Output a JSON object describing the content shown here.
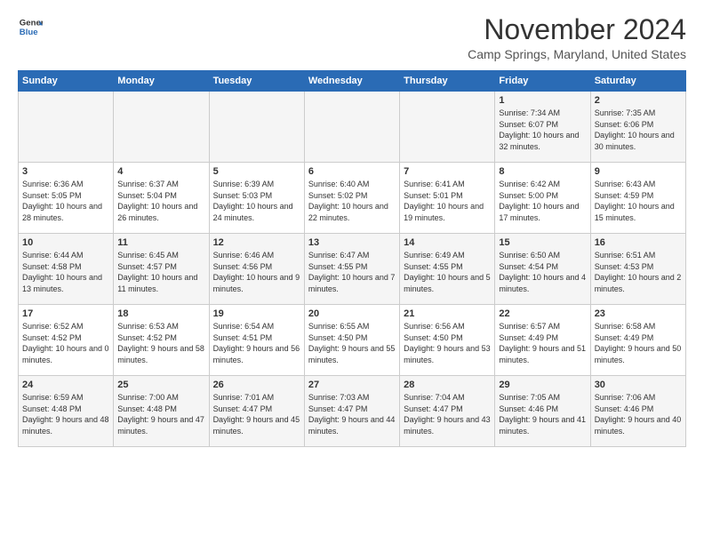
{
  "logo": {
    "general": "General",
    "blue": "Blue"
  },
  "title": "November 2024",
  "subtitle": "Camp Springs, Maryland, United States",
  "days_header": [
    "Sunday",
    "Monday",
    "Tuesday",
    "Wednesday",
    "Thursday",
    "Friday",
    "Saturday"
  ],
  "weeks": [
    [
      {
        "day": "",
        "content": ""
      },
      {
        "day": "",
        "content": ""
      },
      {
        "day": "",
        "content": ""
      },
      {
        "day": "",
        "content": ""
      },
      {
        "day": "",
        "content": ""
      },
      {
        "day": "1",
        "content": "Sunrise: 7:34 AM\nSunset: 6:07 PM\nDaylight: 10 hours and 32 minutes."
      },
      {
        "day": "2",
        "content": "Sunrise: 7:35 AM\nSunset: 6:06 PM\nDaylight: 10 hours and 30 minutes."
      }
    ],
    [
      {
        "day": "3",
        "content": "Sunrise: 6:36 AM\nSunset: 5:05 PM\nDaylight: 10 hours and 28 minutes."
      },
      {
        "day": "4",
        "content": "Sunrise: 6:37 AM\nSunset: 5:04 PM\nDaylight: 10 hours and 26 minutes."
      },
      {
        "day": "5",
        "content": "Sunrise: 6:39 AM\nSunset: 5:03 PM\nDaylight: 10 hours and 24 minutes."
      },
      {
        "day": "6",
        "content": "Sunrise: 6:40 AM\nSunset: 5:02 PM\nDaylight: 10 hours and 22 minutes."
      },
      {
        "day": "7",
        "content": "Sunrise: 6:41 AM\nSunset: 5:01 PM\nDaylight: 10 hours and 19 minutes."
      },
      {
        "day": "8",
        "content": "Sunrise: 6:42 AM\nSunset: 5:00 PM\nDaylight: 10 hours and 17 minutes."
      },
      {
        "day": "9",
        "content": "Sunrise: 6:43 AM\nSunset: 4:59 PM\nDaylight: 10 hours and 15 minutes."
      }
    ],
    [
      {
        "day": "10",
        "content": "Sunrise: 6:44 AM\nSunset: 4:58 PM\nDaylight: 10 hours and 13 minutes."
      },
      {
        "day": "11",
        "content": "Sunrise: 6:45 AM\nSunset: 4:57 PM\nDaylight: 10 hours and 11 minutes."
      },
      {
        "day": "12",
        "content": "Sunrise: 6:46 AM\nSunset: 4:56 PM\nDaylight: 10 hours and 9 minutes."
      },
      {
        "day": "13",
        "content": "Sunrise: 6:47 AM\nSunset: 4:55 PM\nDaylight: 10 hours and 7 minutes."
      },
      {
        "day": "14",
        "content": "Sunrise: 6:49 AM\nSunset: 4:55 PM\nDaylight: 10 hours and 5 minutes."
      },
      {
        "day": "15",
        "content": "Sunrise: 6:50 AM\nSunset: 4:54 PM\nDaylight: 10 hours and 4 minutes."
      },
      {
        "day": "16",
        "content": "Sunrise: 6:51 AM\nSunset: 4:53 PM\nDaylight: 10 hours and 2 minutes."
      }
    ],
    [
      {
        "day": "17",
        "content": "Sunrise: 6:52 AM\nSunset: 4:52 PM\nDaylight: 10 hours and 0 minutes."
      },
      {
        "day": "18",
        "content": "Sunrise: 6:53 AM\nSunset: 4:52 PM\nDaylight: 9 hours and 58 minutes."
      },
      {
        "day": "19",
        "content": "Sunrise: 6:54 AM\nSunset: 4:51 PM\nDaylight: 9 hours and 56 minutes."
      },
      {
        "day": "20",
        "content": "Sunrise: 6:55 AM\nSunset: 4:50 PM\nDaylight: 9 hours and 55 minutes."
      },
      {
        "day": "21",
        "content": "Sunrise: 6:56 AM\nSunset: 4:50 PM\nDaylight: 9 hours and 53 minutes."
      },
      {
        "day": "22",
        "content": "Sunrise: 6:57 AM\nSunset: 4:49 PM\nDaylight: 9 hours and 51 minutes."
      },
      {
        "day": "23",
        "content": "Sunrise: 6:58 AM\nSunset: 4:49 PM\nDaylight: 9 hours and 50 minutes."
      }
    ],
    [
      {
        "day": "24",
        "content": "Sunrise: 6:59 AM\nSunset: 4:48 PM\nDaylight: 9 hours and 48 minutes."
      },
      {
        "day": "25",
        "content": "Sunrise: 7:00 AM\nSunset: 4:48 PM\nDaylight: 9 hours and 47 minutes."
      },
      {
        "day": "26",
        "content": "Sunrise: 7:01 AM\nSunset: 4:47 PM\nDaylight: 9 hours and 45 minutes."
      },
      {
        "day": "27",
        "content": "Sunrise: 7:03 AM\nSunset: 4:47 PM\nDaylight: 9 hours and 44 minutes."
      },
      {
        "day": "28",
        "content": "Sunrise: 7:04 AM\nSunset: 4:47 PM\nDaylight: 9 hours and 43 minutes."
      },
      {
        "day": "29",
        "content": "Sunrise: 7:05 AM\nSunset: 4:46 PM\nDaylight: 9 hours and 41 minutes."
      },
      {
        "day": "30",
        "content": "Sunrise: 7:06 AM\nSunset: 4:46 PM\nDaylight: 9 hours and 40 minutes."
      }
    ]
  ]
}
